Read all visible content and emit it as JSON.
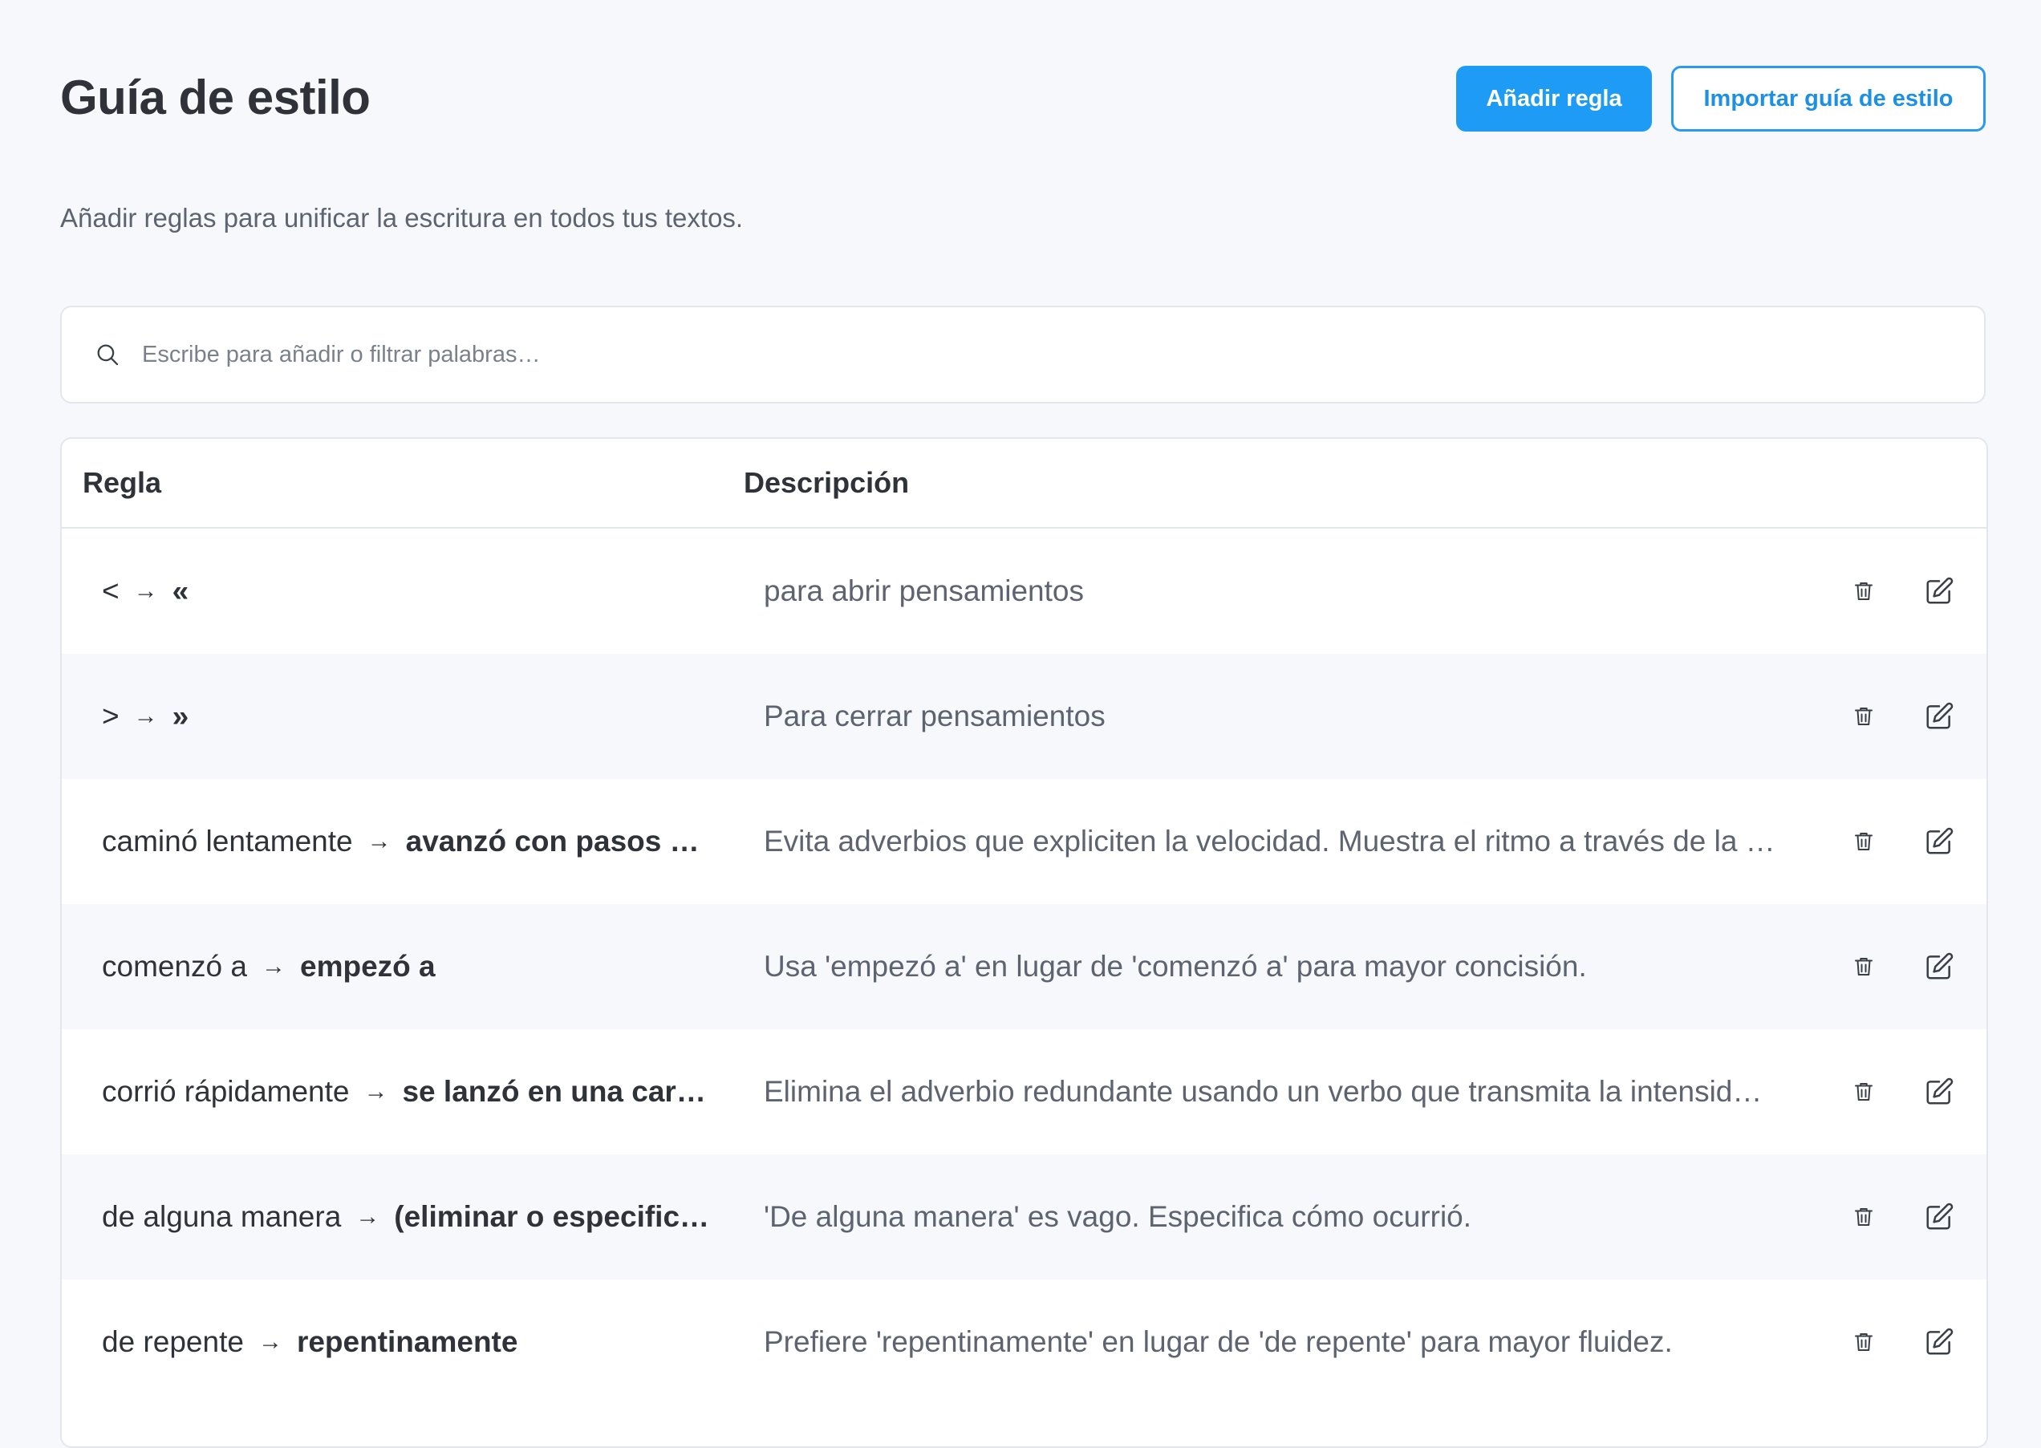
{
  "header": {
    "title": "Guía de estilo",
    "add_rule_label": "Añadir regla",
    "import_label": "Importar guía de estilo"
  },
  "subtitle": "Añadir reglas para unificar la escritura en todos tus textos.",
  "search": {
    "placeholder": "Escribe para añadir o filtrar palabras…",
    "value": "",
    "icon": "search-icon"
  },
  "table": {
    "columns": {
      "rule": "Regla",
      "description": "Descripción"
    },
    "rows": [
      {
        "from": "<",
        "arrow": "→",
        "to": "«",
        "description": "para abrir pensamientos"
      },
      {
        "from": ">",
        "arrow": "→",
        "to": "»",
        "description": "Para cerrar pensamientos"
      },
      {
        "from": "caminó lentamente",
        "arrow": "→",
        "to": "avanzó con pasos …",
        "description": "Evita adverbios que expliciten la velocidad. Muestra el ritmo a través de la …"
      },
      {
        "from": "comenzó a",
        "arrow": "→",
        "to": "empezó a",
        "description": "Usa 'empezó a' en lugar de 'comenzó a' para mayor concisión."
      },
      {
        "from": "corrió rápidamente",
        "arrow": "→",
        "to": "se lanzó en una car…",
        "description": "Elimina el adverbio redundante usando un verbo que transmita la intensid…"
      },
      {
        "from": "de alguna manera",
        "arrow": "→",
        "to": "(eliminar o especific…",
        "description": "'De alguna manera' es vago. Especifica cómo ocurrió."
      },
      {
        "from": "de repente",
        "arrow": "→",
        "to": "repentinamente",
        "description": "Prefiere 'repentinamente' en lugar de 'de repente' para mayor fluidez."
      }
    ],
    "row_actions": {
      "delete_icon": "trash-icon",
      "edit_icon": "edit-icon"
    }
  },
  "colors": {
    "accent": "#1e9cf5",
    "background": "#f7f8fb",
    "alt_row": "#f7f8fb",
    "text": "#2f3238",
    "muted_text": "#5d6470",
    "border": "#e3e6eb"
  }
}
